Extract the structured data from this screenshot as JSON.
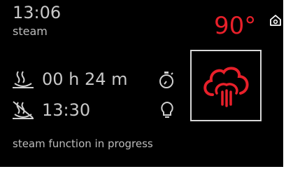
{
  "header": {
    "time": "13:06",
    "mode": "steam"
  },
  "temperature": {
    "value": "90°",
    "color": "#e8202a"
  },
  "icons": {
    "home": "home-icon",
    "duration": "steam-duration-icon",
    "end_time": "end-time-icon",
    "timer": "stopwatch-icon",
    "light": "light-bulb-icon",
    "function": "steam-function-icon"
  },
  "program": {
    "duration": "00 h 24 m",
    "end_time": "13:30"
  },
  "status": {
    "message": "steam function in progress"
  }
}
